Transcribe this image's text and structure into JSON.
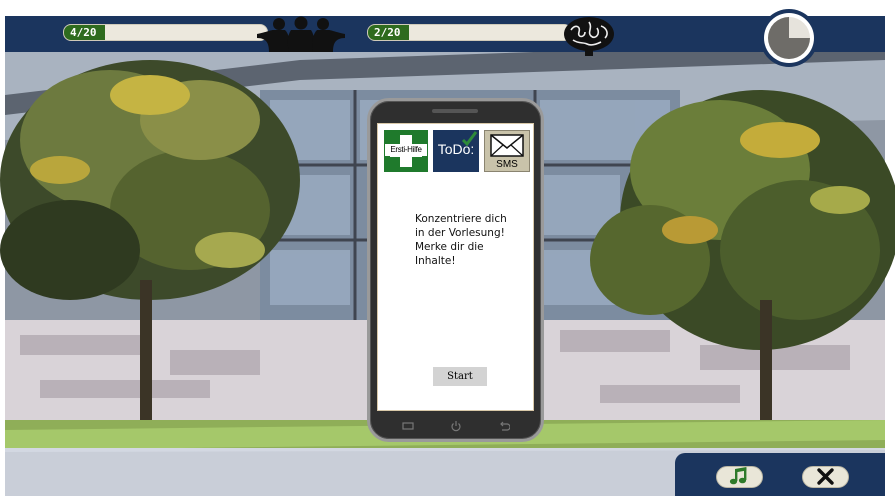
{
  "topbar": {
    "social_meter": {
      "label": "4/20",
      "value": 4,
      "max": 20,
      "icon": "people-group-icon"
    },
    "brain_meter": {
      "label": "2/20",
      "value": 2,
      "max": 20,
      "icon": "brain-icon"
    },
    "timer": {
      "icon": "round-timer-icon",
      "remaining_fraction": 0.25
    }
  },
  "phone": {
    "apps": {
      "first_aid_label": "Ersti-Hilfe",
      "todo_label": "ToDo:",
      "sms_label": "SMS"
    },
    "message_lines": [
      "Konzentriere dich",
      "in der Vorlesung!",
      "Merke dir die",
      "Inhalte!"
    ],
    "start_label": "Start"
  },
  "controls": {
    "music_icon": "music-note-icon",
    "close_icon": "close-icon"
  },
  "colors": {
    "bar_navy": "#1b355e",
    "meter_green": "#2e6b1e",
    "first_aid_green": "#1f7a2c"
  }
}
